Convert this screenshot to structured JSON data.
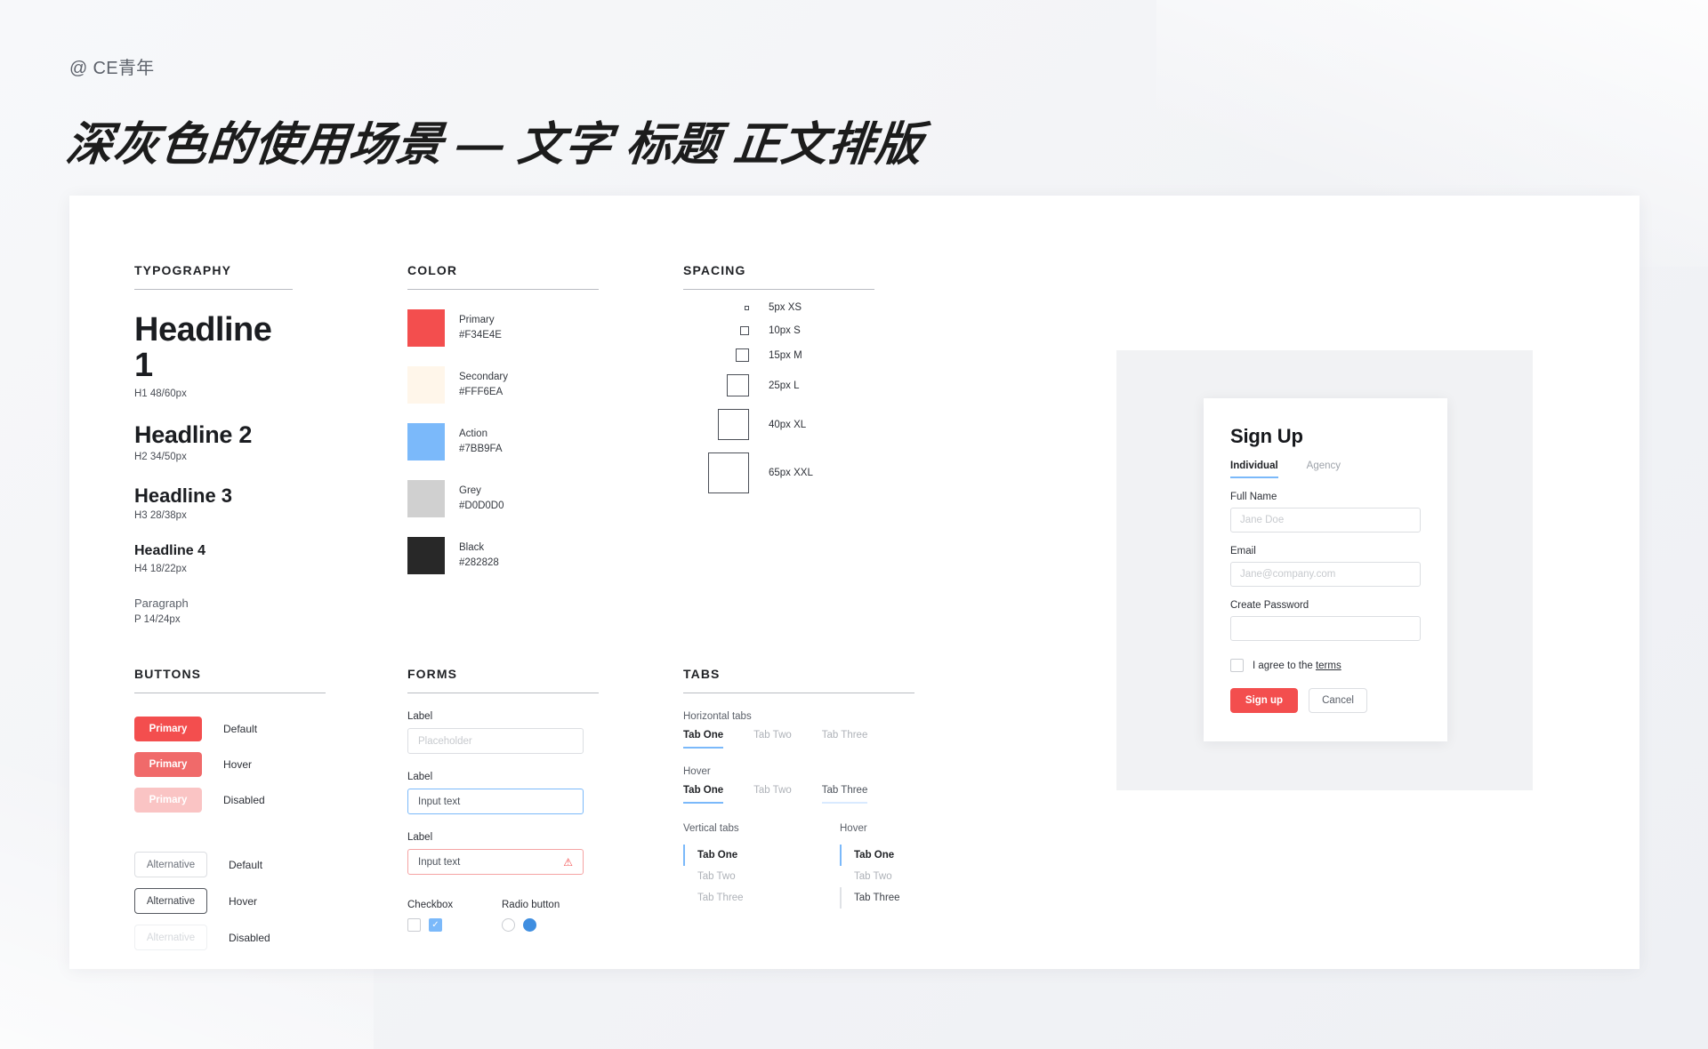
{
  "header": {
    "handle": "@ CE青年",
    "title": "深灰色的使用场景 — 文字 标题 正文排版"
  },
  "typography": {
    "section_title": "TYPOGRAPHY",
    "items": [
      {
        "sample": "Headline 1",
        "spec": "H1 48/60px"
      },
      {
        "sample": "Headline 2",
        "spec": "H2 34/50px"
      },
      {
        "sample": "Headline 3",
        "spec": "H3 28/38px"
      },
      {
        "sample": "Headline 4",
        "spec": "H4 18/22px"
      },
      {
        "sample": "Paragraph",
        "spec": "P 14/24px"
      }
    ]
  },
  "color": {
    "section_title": "COLOR",
    "items": [
      {
        "name": "Primary",
        "hex": "#F34E4E"
      },
      {
        "name": "Secondary",
        "hex": "#FFF6EA"
      },
      {
        "name": "Action",
        "hex": "#7BB9FA"
      },
      {
        "name": "Grey",
        "hex": "#D0D0D0"
      },
      {
        "name": "Black",
        "hex": "#282828"
      }
    ]
  },
  "spacing": {
    "section_title": "SPACING",
    "items": [
      {
        "label": "5px XS",
        "size": 5
      },
      {
        "label": "10px S",
        "size": 10
      },
      {
        "label": "15px M",
        "size": 15
      },
      {
        "label": "25px L",
        "size": 25
      },
      {
        "label": "40px XL",
        "size": 40
      },
      {
        "label": "65px XXL",
        "size": 65
      }
    ]
  },
  "buttons": {
    "section_title": "BUTTONS",
    "primary_label": "Primary",
    "alternative_label": "Alternative",
    "states": {
      "default": "Default",
      "hover": "Hover",
      "disabled": "Disabled"
    }
  },
  "forms": {
    "section_title": "FORMS",
    "label": "Label",
    "placeholder_value": "Placeholder",
    "input_text_value": "Input text",
    "error_icon": "⚠",
    "checkbox_label": "Checkbox",
    "radio_label": "Radio button",
    "check_glyph": "✓"
  },
  "tabs": {
    "section_title": "TABS",
    "horizontal_label": "Horizontal tabs",
    "hover_label": "Hover",
    "vertical_label": "Vertical tabs",
    "vertical_hover_label": "Hover",
    "items": [
      "Tab One",
      "Tab Two",
      "Tab Three"
    ]
  },
  "signup": {
    "title": "Sign Up",
    "tabs": [
      "Individual",
      "Agency"
    ],
    "fields": [
      {
        "label": "Full Name",
        "placeholder": "Jane Doe"
      },
      {
        "label": "Email",
        "placeholder": "Jane@company.com"
      },
      {
        "label": "Create Password",
        "placeholder": ""
      }
    ],
    "terms_prefix": "I agree to the ",
    "terms_link": "terms",
    "submit_label": "Sign up",
    "cancel_label": "Cancel"
  }
}
